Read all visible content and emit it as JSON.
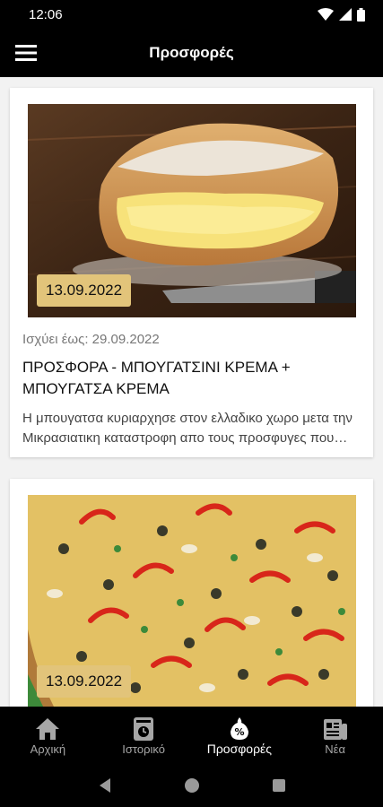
{
  "status_bar": {
    "time": "12:06",
    "icons": [
      "wifi-icon",
      "signal-icon",
      "battery-icon"
    ]
  },
  "header": {
    "title": "Προσφορές",
    "menu_icon": "hamburger-menu-icon"
  },
  "offers": [
    {
      "date": "13.09.2022",
      "valid_until": "Ισχύει έως: 29.09.2022",
      "title": "ΠΡΟΣΦΟΡΑ - ΜΠΟΥΓΑΤΣΙΝΙ ΚΡΕΜΑ + ΜΠΟΥΓΑΤΣΑ ΚΡΕΜΑ",
      "description": "Η μπουγατσα κυριαρχησε στον ελλαδικο χωρο μετα την Μικρασιατικη καταστροφη απο τους προσφυγες που εφεραν μαζι τους την τεχνη της",
      "image": "bougatsa-photo"
    },
    {
      "date": "13.09.2022",
      "image": "pizza-photo"
    }
  ],
  "bottom_nav": {
    "items": [
      {
        "label": "Αρχική",
        "icon": "home-icon",
        "active": false
      },
      {
        "label": "Ιστορικό",
        "icon": "history-icon",
        "active": false
      },
      {
        "label": "Προσφορές",
        "icon": "offers-icon",
        "active": true
      },
      {
        "label": "Νέα",
        "icon": "news-icon",
        "active": false
      }
    ]
  },
  "system_nav": [
    "back-icon",
    "home-circle-icon",
    "recents-icon"
  ],
  "colors": {
    "background": "#000000",
    "badge": "#e2c47a",
    "content_bg": "#f2f2f2",
    "nav_inactive": "#a6a6a6"
  }
}
